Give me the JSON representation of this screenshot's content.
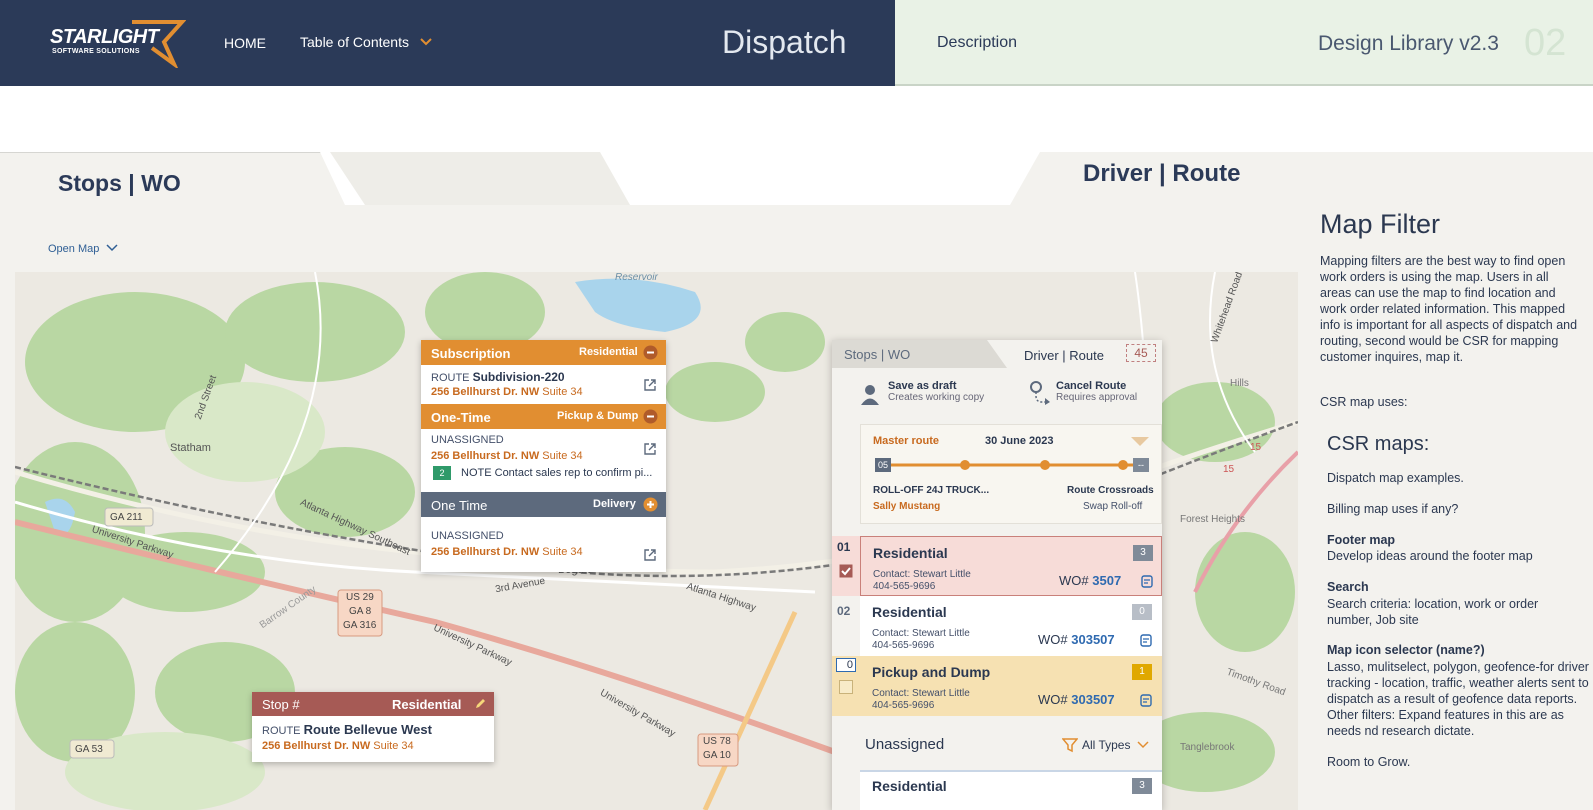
{
  "header": {
    "logo_main": "STARLIGHT",
    "logo_sub": "SOFTWARE SOLUTIONS",
    "nav_home": "HOME",
    "nav_toc": "Table of Contents",
    "app_title": "Dispatch",
    "description": "Description",
    "library": "Design Library v2.3",
    "page_num": "02"
  },
  "tabs": {
    "stops": "Stops | WO",
    "driver": "Driver | Route"
  },
  "open_map": "Open Map",
  "map_labels": {
    "reservoir": "Reservoir",
    "statham": "Statham",
    "bogart": "Bogart",
    "hills": "Hills",
    "forest": "Forest Heights",
    "tanglebrook": "Tanglebrook",
    "timothy": "Timothy Road",
    "ga211": "GA 211",
    "us29": "US 29",
    "ga8": "GA 8",
    "ga316": "GA 316",
    "ga53": "GA 53",
    "us78": "US 78",
    "ga10": "GA 10",
    "univ1": "University Parkway",
    "univ2": "University Parkway",
    "univ3": "University Parkway",
    "atlanta1": "Atlanta Highway Southeast",
    "atlanta2": "Atlanta Highway",
    "barrow": "Barrow County",
    "rd3": "3rd Avenue",
    "street": "2nd Street",
    "whitehead": "Whitehead Road",
    "n15a": "15",
    "n15b": "15"
  },
  "popups": {
    "sub": {
      "title": "Subscription",
      "tag": "Residential",
      "route_lbl": "ROUTE",
      "route": "Subdivision-220",
      "addr": "256 Bellhurst Dr. NW",
      "suite": "Suite 34"
    },
    "one": {
      "title": "One-Time",
      "tag": "Pickup & Dump",
      "status": "UNASSIGNED",
      "addr": "256 Bellhurst Dr. NW",
      "suite": "Suite 34",
      "count": "2",
      "note_lbl": "NOTE",
      "note": "Contact sales rep to confirm pi..."
    },
    "del": {
      "title": "One Time",
      "tag": "Delivery",
      "status": "UNASSIGNED",
      "addr": "256 Bellhurst Dr. NW",
      "suite": "Suite 34"
    },
    "stop": {
      "title": "Stop #",
      "tag": "Residential",
      "route_lbl": "ROUTE",
      "route": "Route Bellevue West",
      "addr": "256 Bellhurst Dr. NW",
      "suite": "Suite 34"
    }
  },
  "route_panel": {
    "tab_stops": "Stops | WO",
    "tab_driver": "Driver | Route",
    "badge": "45",
    "save": "Save as draft",
    "save_sub": "Creates working copy",
    "cancel": "Cancel Route",
    "cancel_sub": "Requires approval",
    "master": "Master route",
    "date": "30 June 2023",
    "start": "05",
    "end": "--",
    "truck": "ROLL-OFF 24J TRUCK...",
    "crossroads": "Route Crossroads",
    "driver": "Sally Mustang",
    "swap": "Swap Roll-off",
    "stops": [
      {
        "num": "01",
        "title": "Residential",
        "contact": "Contact: Stewart Little",
        "phone": "404-565-9696",
        "wo_lbl": "WO#",
        "wo": "3507",
        "count": "3"
      },
      {
        "num": "02",
        "title": "Residential",
        "contact": "Contact: Stewart Little",
        "phone": "404-565-9696",
        "wo_lbl": "WO#",
        "wo": "303507",
        "count": "0"
      },
      {
        "num": "0",
        "title": "Pickup and Dump",
        "contact": "Contact: Stewart Little",
        "phone": "404-565-9696",
        "wo_lbl": "WO#",
        "wo": "303507",
        "count": "1"
      }
    ],
    "unassigned": "Unassigned",
    "all_types": "All Types",
    "un_title": "Residential",
    "un_count": "3"
  },
  "sidebar": {
    "title": "Map Filter",
    "intro": "Mapping filters are the  best way to find open work orders is using the map. Users in all areas can use the map to find location and work order related information. This mapped info is important for all aspects of dispatch and routing, second would be CSR for mapping customer inquires, map it.",
    "csr_uses": "CSR map uses:",
    "csr_maps": "CSR maps:",
    "dispatch": "Dispatch map examples.",
    "billing": "Billing map uses if any?",
    "footer_h": "Footer map",
    "footer_t": "Develop ideas around the footer map",
    "search_h": "Search",
    "search_t": "Search criteria:  location, work or order number, Job site",
    "icon_h": "Map icon selector (name?)",
    "icon_t": "Lasso, mulitselect, polygon, geofence-for driver tracking - location, traffic, weather alerts sent to dispatch as a result of geofence data reports. Other filters: Expand features in this are  as needs nd research dictate.",
    "grow": "Room to Grow."
  },
  "colors": {
    "navy": "#2b3a58",
    "orange": "#e18e31",
    "slate": "#5d6a7d",
    "brick": "#a65a55",
    "mint": "#e9f2e6"
  }
}
